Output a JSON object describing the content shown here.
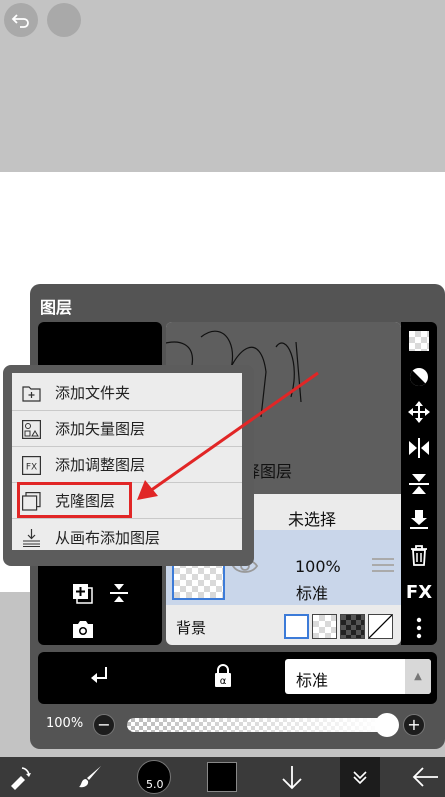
{
  "panel": {
    "title": "图层"
  },
  "popup_menu": {
    "items": [
      {
        "label": "添加文件夹",
        "icon": "add-folder-icon"
      },
      {
        "label": "添加矢量图层",
        "icon": "vector-layer-icon"
      },
      {
        "label": "添加调整图层",
        "icon": "adjustment-layer-icon"
      },
      {
        "label": "克隆图层",
        "icon": "clone-layer-icon"
      },
      {
        "label": "从画布添加图层",
        "icon": "layer-from-canvas-icon"
      }
    ],
    "highlighted": "克隆图层"
  },
  "layer_area": {
    "select_label": "择图层",
    "unselect_label": "未选择"
  },
  "layer": {
    "opacity": "100%",
    "blend": "标准"
  },
  "background": {
    "label": "背景"
  },
  "blend_bar": {
    "mode": "标准"
  },
  "opacity_slider": {
    "label": "100%",
    "value": 1.0
  },
  "brush": {
    "size": "5.0"
  },
  "side_icons": {
    "fx_label": "FX"
  },
  "colors": {
    "accent": "#e12626",
    "selection": "#3c7bd8",
    "panel": "#545454"
  }
}
